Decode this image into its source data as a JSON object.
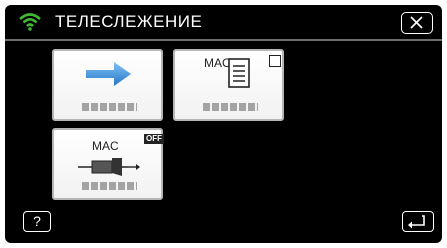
{
  "header": {
    "title": "ТЕЛЕСЛЕЖЕНИЕ",
    "wifi_icon": "wifi-icon",
    "close_icon": "close-icon"
  },
  "tiles": [
    {
      "icon": "arrow-right-icon",
      "placeholder_label": "blurred-text"
    },
    {
      "label": "MAC",
      "icon": "document-icon",
      "checkbox": "unchecked",
      "placeholder_label": "blurred-text"
    },
    {
      "label": "MAC",
      "badge": "OFF",
      "icon": "projector-icon",
      "placeholder_label": "blurred-text"
    }
  ],
  "footer": {
    "help_label": "?",
    "back_icon": "return-icon"
  },
  "colors": {
    "background": "#000000",
    "wifi_green": "#3fb934",
    "arrow_blue": "#3a8fd9"
  }
}
